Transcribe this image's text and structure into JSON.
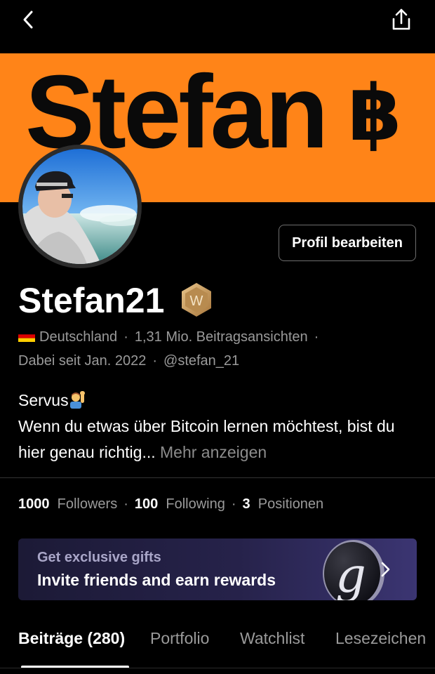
{
  "header": {
    "back_icon": "chevron-left-icon",
    "share_icon": "share-icon"
  },
  "banner": {
    "logo_text": "Stefan",
    "logo_symbol": "฿",
    "background_color": "#ff8418"
  },
  "profile": {
    "edit_button_label": "Profil bearbeiten",
    "name": "Stefan21",
    "badge_letter": "W",
    "country": "Deutschland",
    "views": "1,31 Mio. Beitragsansichten",
    "joined": "Dabei seit Jan. 2022",
    "handle": "@stefan_21",
    "bio_line1": "Servus",
    "bio_line2": "Wenn du etwas über Bitcoin lernen möchtest, bist du hier genau richtig...",
    "bio_more": " Mehr anzeigen"
  },
  "stats": {
    "followers_count": "1000",
    "followers_label": "Followers",
    "following_count": "100",
    "following_label": "Following",
    "positions_count": "3",
    "positions_label": "Positionen"
  },
  "promo": {
    "subtitle": "Get exclusive gifts",
    "title": "Invite friends and earn rewards",
    "coin_letter": "g"
  },
  "tabs": [
    {
      "label": "Beiträge (280)",
      "active": true
    },
    {
      "label": "Portfolio",
      "active": false
    },
    {
      "label": "Watchlist",
      "active": false
    },
    {
      "label": "Lesezeichen",
      "active": false
    }
  ]
}
